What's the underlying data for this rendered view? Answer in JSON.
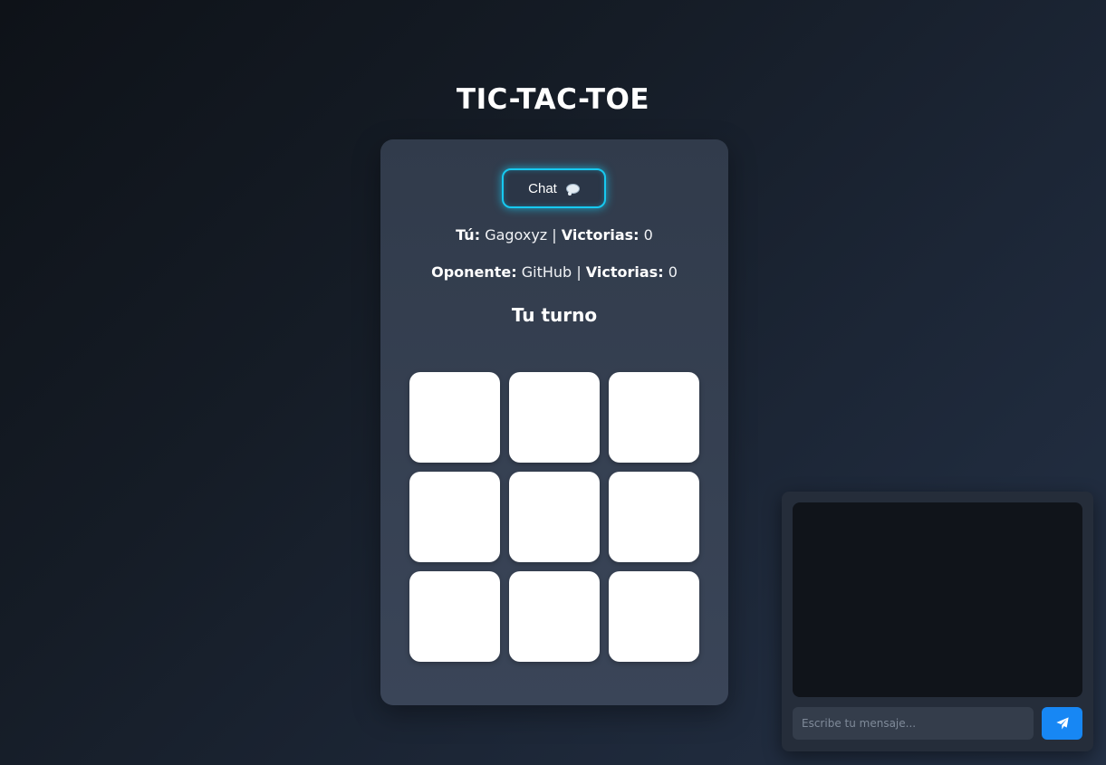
{
  "title": "TIC-TAC-TOE",
  "chat_button": {
    "label": "Chat",
    "icon": "speech-bubble-icon"
  },
  "player": {
    "label": "Tú:",
    "name": "Gagoxyz",
    "separator": "|",
    "wins_label": "Victorias:",
    "wins": "0"
  },
  "opponent": {
    "label": "Oponente:",
    "name": "GitHub",
    "separator": "|",
    "wins_label": "Victorias:",
    "wins": "0"
  },
  "turn_text": "Tu turno",
  "board": [
    "",
    "",
    "",
    "",
    "",
    "",
    "",
    "",
    ""
  ],
  "chat_panel": {
    "messages": [],
    "input_placeholder": "Escribe tu mensaje...",
    "send_icon": "paper-plane-icon"
  },
  "colors": {
    "accent_glow": "#17c9f0",
    "send_button": "#1787f4",
    "card_background": "#343e4f",
    "cell_background": "#ffffff"
  }
}
